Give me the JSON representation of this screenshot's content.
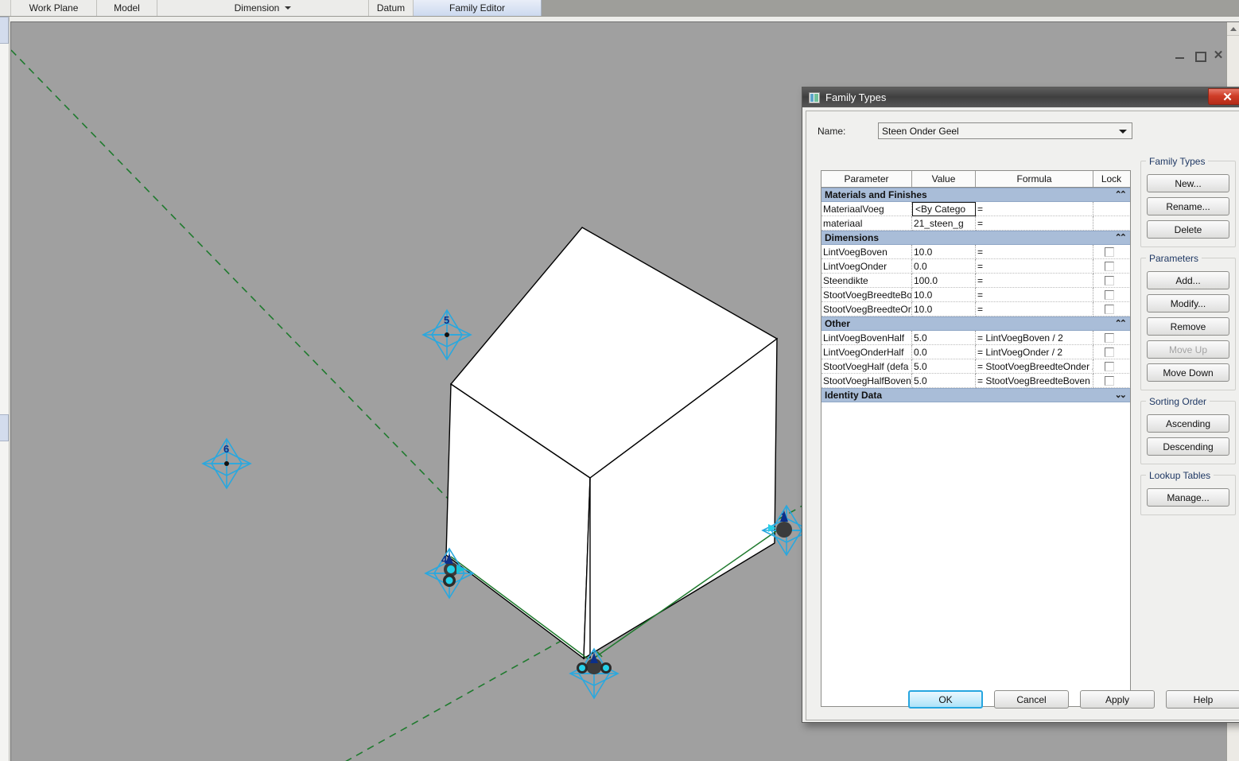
{
  "ribbon": {
    "tabs": [
      {
        "label": "Work Plane",
        "dropdown": false
      },
      {
        "label": "Model",
        "dropdown": false
      },
      {
        "label": "Dimension",
        "dropdown": true
      },
      {
        "label": "Datum",
        "dropdown": false
      },
      {
        "label": "Family Editor",
        "dropdown": false,
        "active": true
      }
    ]
  },
  "view": {
    "window_buttons": {
      "minimize": "minimize-icon",
      "restore": "restore-icon",
      "close": "close-icon"
    },
    "background_color": "#a0a0a0",
    "reference_plane_color": "#1f7a2e",
    "point_marker_color": "#29a8df",
    "point_labels": [
      "1",
      "4",
      "5",
      "6"
    ],
    "solid_face_color": "#ffffff",
    "solid_edge_color": "#000000",
    "base_band_color": "#9aa790"
  },
  "dialog": {
    "title": "Family Types",
    "close_label": "✕",
    "name_label": "Name:",
    "name_value": "Steen Onder Geel",
    "table": {
      "headers": [
        "Parameter",
        "Value",
        "Formula",
        "Lock"
      ],
      "groups": [
        {
          "title": "Materials and Finishes",
          "collapsed": false,
          "chevron": "«",
          "rows": [
            {
              "parameter": "MateriaalVoeg",
              "value": "<By Catego",
              "formula": "=",
              "lock": false,
              "editing": true
            },
            {
              "parameter": "materiaal",
              "value": "21_steen_g",
              "formula": "=",
              "lock": false,
              "editing": false
            }
          ]
        },
        {
          "title": "Dimensions",
          "collapsed": false,
          "chevron": "«",
          "rows": [
            {
              "parameter": "LintVoegBoven",
              "value": "10.0",
              "formula": "=",
              "lock": true,
              "editing": false
            },
            {
              "parameter": "LintVoegOnder",
              "value": "0.0",
              "formula": "=",
              "lock": true,
              "editing": false
            },
            {
              "parameter": "Steendikte",
              "value": "100.0",
              "formula": "=",
              "lock": true,
              "editing": false
            },
            {
              "parameter": "StootVoegBreedteBo",
              "value": "10.0",
              "formula": "=",
              "lock": true,
              "editing": false
            },
            {
              "parameter": "StootVoegBreedteOn",
              "value": "10.0",
              "formula": "=",
              "lock": true,
              "editing": false
            }
          ]
        },
        {
          "title": "Other",
          "collapsed": false,
          "chevron": "«",
          "rows": [
            {
              "parameter": "LintVoegBovenHalf",
              "value": "5.0",
              "formula": "= LintVoegBoven / 2",
              "lock": true,
              "editing": false
            },
            {
              "parameter": "LintVoegOnderHalf",
              "value": "0.0",
              "formula": "= LintVoegOnder / 2",
              "lock": true,
              "editing": false
            },
            {
              "parameter": "StootVoegHalf (defa",
              "value": "5.0",
              "formula": "= StootVoegBreedteOnder /",
              "lock": true,
              "editing": false
            },
            {
              "parameter": "StootVoegHalfBoven",
              "value": "5.0",
              "formula": "= StootVoegBreedteBoven /",
              "lock": true,
              "editing": false
            }
          ]
        },
        {
          "title": "Identity Data",
          "collapsed": true,
          "chevron": "»",
          "rows": []
        }
      ]
    },
    "side_panels": [
      {
        "legend": "Family Types",
        "buttons": [
          {
            "label": "New...",
            "disabled": false
          },
          {
            "label": "Rename...",
            "disabled": false
          },
          {
            "label": "Delete",
            "disabled": false
          }
        ]
      },
      {
        "legend": "Parameters",
        "buttons": [
          {
            "label": "Add...",
            "disabled": false
          },
          {
            "label": "Modify...",
            "disabled": false
          },
          {
            "label": "Remove",
            "disabled": false
          },
          {
            "label": "Move Up",
            "disabled": true
          },
          {
            "label": "Move Down",
            "disabled": false
          }
        ]
      },
      {
        "legend": "Sorting Order",
        "buttons": [
          {
            "label": "Ascending",
            "disabled": false
          },
          {
            "label": "Descending",
            "disabled": false
          }
        ]
      },
      {
        "legend": "Lookup Tables",
        "buttons": [
          {
            "label": "Manage...",
            "disabled": false
          }
        ]
      }
    ],
    "footer_buttons": [
      {
        "label": "OK",
        "default": true
      },
      {
        "label": "Cancel",
        "default": false
      },
      {
        "label": "Apply",
        "default": false
      },
      {
        "label": "Help",
        "default": false
      }
    ]
  }
}
